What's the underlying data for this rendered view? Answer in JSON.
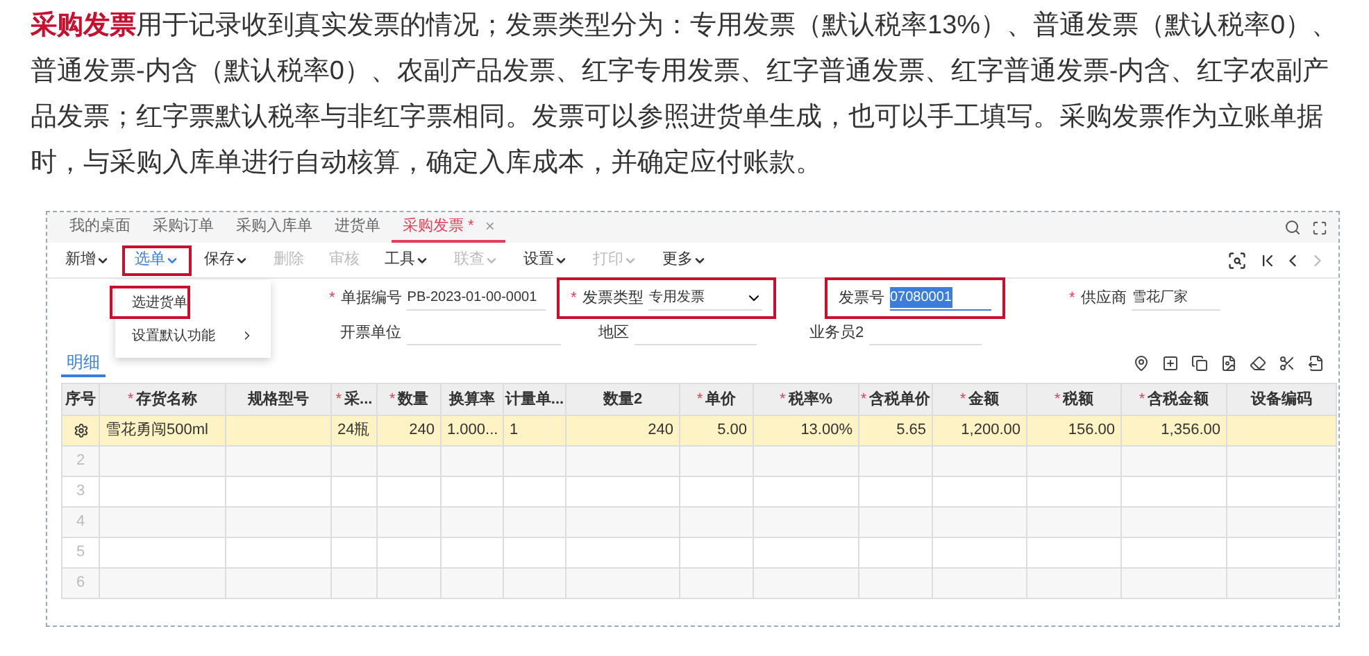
{
  "intro": "**采购发票**用于记录收到真实发票的情况；发票类型分为：专用发票（默认税率13%）、普通发票（默认税率0）、普通发票-内含（默认税率0）、农副产品发票、红字专用发票、红字普通发票、红字普通发票-内含、红字农副产品发票；红字票默认税率与非红字票相同。发票可以参照进货单生成，也可以手工填写。采购发票作为立账单据时，与采购入库单进行自动核算，确定入库成本，并确定应付账款。",
  "tabs": [
    {
      "label": "我的桌面",
      "selected": false
    },
    {
      "label": "采购订单",
      "selected": false
    },
    {
      "label": "采购入库单",
      "selected": false
    },
    {
      "label": "进货单",
      "selected": false
    },
    {
      "label": "采购发票 *",
      "selected": true,
      "close": "×"
    }
  ],
  "toolbar": [
    {
      "label": "新增",
      "caret": true,
      "disabled": false,
      "active": false
    },
    {
      "label": "选单",
      "caret": true,
      "disabled": false,
      "active": true
    },
    {
      "label": "保存",
      "caret": true,
      "disabled": false,
      "active": false
    },
    {
      "label": "删除",
      "caret": false,
      "disabled": true,
      "active": false
    },
    {
      "label": "审核",
      "caret": false,
      "disabled": true,
      "active": false
    },
    {
      "label": "工具",
      "caret": true,
      "disabled": false,
      "active": false
    },
    {
      "label": "联查",
      "caret": true,
      "disabled": true,
      "active": false
    },
    {
      "label": "设置",
      "caret": true,
      "disabled": false,
      "active": false
    },
    {
      "label": "打印",
      "caret": true,
      "disabled": true,
      "active": false
    },
    {
      "label": "更多",
      "caret": true,
      "disabled": false,
      "active": false
    }
  ],
  "menu": [
    {
      "label": "选进货单",
      "submenu": false,
      "highlighted": true
    },
    {
      "label": "设置默认功能",
      "submenu": true,
      "highlighted": false
    }
  ],
  "form": [
    {
      "marker": "*",
      "label": "单据编号",
      "value": "PB-2023-01-00-0001",
      "kind": "text",
      "highlighted": false,
      "selected_text": false
    },
    {
      "marker": "*",
      "label": "发票类型",
      "value": "专用发票",
      "kind": "select",
      "highlighted": true,
      "selected_text": false
    },
    {
      "label": "发票号",
      "value": "07080001",
      "kind": "text",
      "highlighted": true,
      "selected_text": true
    },
    {
      "marker": "*",
      "label": "供应商",
      "value": "雪花厂家",
      "kind": "text",
      "highlighted": false,
      "selected_text": false
    },
    {
      "label": "开票单位",
      "kind": "text",
      "highlighted": false,
      "selected_text": false
    },
    {
      "label": "地区",
      "kind": "text",
      "highlighted": false,
      "selected_text": false
    },
    {
      "label": "业务员2",
      "kind": "text",
      "highlighted": false,
      "selected_text": false
    }
  ],
  "detail_tab": {
    "label": "明细",
    "selected": true
  },
  "table": {
    "columns": [
      {
        "label": "序号"
      },
      {
        "marker": "*",
        "label": "存货名称"
      },
      {
        "label": "规格型号"
      },
      {
        "marker": "*",
        "label": "采..."
      },
      {
        "marker": "*",
        "label": "数量"
      },
      {
        "label": "换算率"
      },
      {
        "label": "计量单..."
      },
      {
        "label": "数量2"
      },
      {
        "marker": "*",
        "label": "单价"
      },
      {
        "marker": "*",
        "label": "税率%"
      },
      {
        "marker": "*",
        "label": "含税单价"
      },
      {
        "marker": "*",
        "label": "金额"
      },
      {
        "marker": "*",
        "label": "税额"
      },
      {
        "marker": "*",
        "label": "含税金额"
      },
      {
        "label": "设备编码"
      }
    ],
    "rows": [
      {
        "selected": true,
        "cells": [
          "",
          "雪花勇闯500ml",
          "",
          "24瓶",
          "240",
          "1.000...",
          "1",
          "240",
          "5.00",
          "13.00%",
          "5.65",
          "1,200.00",
          "156.00",
          "1,356.00",
          ""
        ]
      },
      {
        "selected": false,
        "cells": [
          "2",
          "",
          "",
          "",
          "",
          "",
          "",
          "",
          "",
          "",
          "",
          "",
          "",
          "",
          ""
        ]
      },
      {
        "selected": false,
        "cells": [
          "3",
          "",
          "",
          "",
          "",
          "",
          "",
          "",
          "",
          "",
          "",
          "",
          "",
          "",
          ""
        ]
      },
      {
        "selected": false,
        "cells": [
          "4",
          "",
          "",
          "",
          "",
          "",
          "",
          "",
          "",
          "",
          "",
          "",
          "",
          "",
          ""
        ]
      },
      {
        "selected": false,
        "cells": [
          "5",
          "",
          "",
          "",
          "",
          "",
          "",
          "",
          "",
          "",
          "",
          "",
          "",
          "",
          ""
        ]
      },
      {
        "selected": false,
        "cells": [
          "6",
          "",
          "",
          "",
          "",
          "",
          "",
          "",
          "",
          "",
          "",
          "",
          "",
          "",
          ""
        ]
      }
    ]
  }
}
